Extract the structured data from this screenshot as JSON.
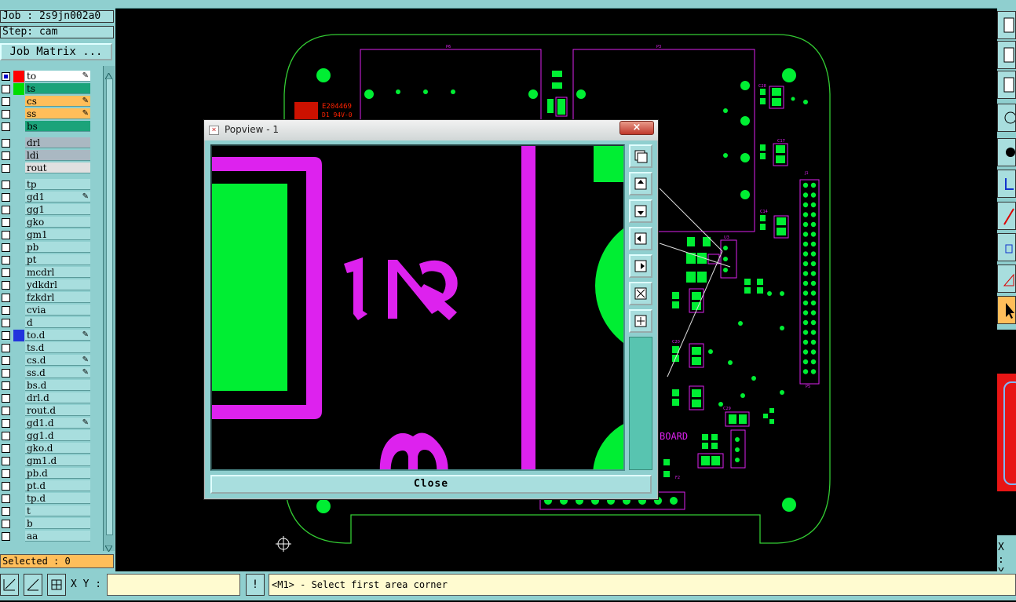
{
  "job": {
    "label": "Job : 2s9jn002a0",
    "step": "Step: cam"
  },
  "job_matrix_label": "Job Matrix ...",
  "layers": [
    {
      "name": "to",
      "color": "#ffffff",
      "swatch": "#ff0000",
      "checked": true,
      "edit": true
    },
    {
      "name": "ts",
      "color": "#1ba37a",
      "swatch": "#00dd00",
      "checked": false,
      "edit": false
    },
    {
      "name": "cs",
      "color": "#ffbe5a",
      "swatch": "",
      "checked": false,
      "edit": true
    },
    {
      "name": "ss",
      "color": "#ffbe5a",
      "swatch": "",
      "checked": false,
      "edit": true
    },
    {
      "name": "bs",
      "color": "#1ba37a",
      "swatch": "",
      "checked": false,
      "edit": false
    },
    {
      "name": "drl",
      "color": "#aab8c2",
      "swatch": "",
      "checked": false,
      "edit": false,
      "gap": true
    },
    {
      "name": "ldi",
      "color": "#aab8c2",
      "swatch": "",
      "checked": false,
      "edit": false
    },
    {
      "name": "rout",
      "color": "#e0e0e0",
      "swatch": "",
      "checked": false,
      "edit": false
    },
    {
      "name": "tp",
      "color": "#a8dede",
      "swatch": "",
      "checked": false,
      "edit": false,
      "gap": true
    },
    {
      "name": "gd1",
      "color": "#a8dede",
      "swatch": "",
      "checked": false,
      "edit": true
    },
    {
      "name": "gg1",
      "color": "#a8dede",
      "swatch": "",
      "checked": false,
      "edit": false
    },
    {
      "name": "gko",
      "color": "#a8dede",
      "swatch": "",
      "checked": false,
      "edit": false
    },
    {
      "name": "gm1",
      "color": "#a8dede",
      "swatch": "",
      "checked": false,
      "edit": false
    },
    {
      "name": "pb",
      "color": "#a8dede",
      "swatch": "",
      "checked": false,
      "edit": false
    },
    {
      "name": "pt",
      "color": "#a8dede",
      "swatch": "",
      "checked": false,
      "edit": false
    },
    {
      "name": "mcdrl",
      "color": "#a8dede",
      "swatch": "",
      "checked": false,
      "edit": false
    },
    {
      "name": "ydkdrl",
      "color": "#a8dede",
      "swatch": "",
      "checked": false,
      "edit": false
    },
    {
      "name": "fzkdrl",
      "color": "#a8dede",
      "swatch": "",
      "checked": false,
      "edit": false
    },
    {
      "name": "cvia",
      "color": "#a8dede",
      "swatch": "",
      "checked": false,
      "edit": false
    },
    {
      "name": "d",
      "color": "#a8dede",
      "swatch": "",
      "checked": false,
      "edit": false
    },
    {
      "name": "to.d",
      "color": "#a8dede",
      "swatch": "#2233dd",
      "checked": false,
      "edit": true
    },
    {
      "name": "ts.d",
      "color": "#a8dede",
      "swatch": "",
      "checked": false,
      "edit": false
    },
    {
      "name": "cs.d",
      "color": "#a8dede",
      "swatch": "",
      "checked": false,
      "edit": true
    },
    {
      "name": "ss.d",
      "color": "#a8dede",
      "swatch": "",
      "checked": false,
      "edit": true
    },
    {
      "name": "bs.d",
      "color": "#a8dede",
      "swatch": "",
      "checked": false,
      "edit": false
    },
    {
      "name": "drl.d",
      "color": "#a8dede",
      "swatch": "",
      "checked": false,
      "edit": false
    },
    {
      "name": "rout.d",
      "color": "#a8dede",
      "swatch": "",
      "checked": false,
      "edit": false
    },
    {
      "name": "gd1.d",
      "color": "#a8dede",
      "swatch": "",
      "checked": false,
      "edit": true
    },
    {
      "name": "gg1.d",
      "color": "#a8dede",
      "swatch": "",
      "checked": false,
      "edit": false
    },
    {
      "name": "gko.d",
      "color": "#a8dede",
      "swatch": "",
      "checked": false,
      "edit": false
    },
    {
      "name": "gm1.d",
      "color": "#a8dede",
      "swatch": "",
      "checked": false,
      "edit": false
    },
    {
      "name": "pb.d",
      "color": "#a8dede",
      "swatch": "",
      "checked": false,
      "edit": false
    },
    {
      "name": "pt.d",
      "color": "#a8dede",
      "swatch": "",
      "checked": false,
      "edit": false
    },
    {
      "name": "tp.d",
      "color": "#a8dede",
      "swatch": "",
      "checked": false,
      "edit": false
    },
    {
      "name": "t",
      "color": "#a8dede",
      "swatch": "",
      "checked": false,
      "edit": false
    },
    {
      "name": "b",
      "color": "#a8dede",
      "swatch": "",
      "checked": false,
      "edit": false
    },
    {
      "name": "aa",
      "color": "#a8dede",
      "swatch": "",
      "checked": false,
      "edit": false
    }
  ],
  "selected_label": "Selected : 0",
  "bottom": {
    "xy_label": "X Y :",
    "xy_value": "",
    "message": "<M1> - Select first area corner",
    "exclaim": "!"
  },
  "right_readout": {
    "x": "X :",
    "y": "Y :"
  },
  "popview": {
    "title": "Popview - 1",
    "close_label": "Close",
    "close_x": "×"
  },
  "board": {
    "labels": {
      "p6": "P6",
      "p3": "P3",
      "u3": "U3",
      "u5": "U5",
      "j1": "J1",
      "f2": "F2",
      "p5": "P5",
      "c20": "C20",
      "c16": "C16",
      "c17": "C17",
      "c14": "C14",
      "c19": "C19",
      "c18": "C18",
      "c13": "C13",
      "c28": "C28",
      "c29": "C29",
      "c7": "C7",
      "r3": "R3",
      "r4": "R4",
      "e204469": "E204469",
      "d1": "D1 94V-0",
      "board": "BOARD"
    }
  },
  "colors": {
    "board_outline": "#33cc33",
    "pad": "#00ee33",
    "silk": "#dd22ee",
    "panel": "#8fcfcf",
    "marker": "#ff2200"
  }
}
